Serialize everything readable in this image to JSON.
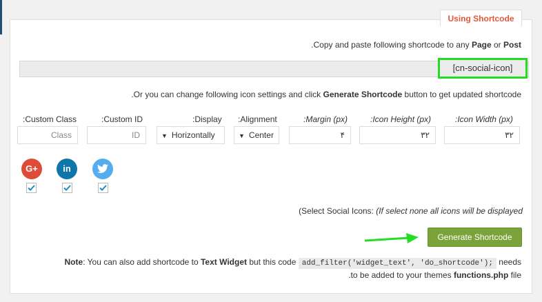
{
  "tab_title": "Using Shortcode",
  "intro": {
    "prefix": ".Copy and paste following shortcode to any ",
    "page": "Page",
    "or": " or ",
    "post": "Post"
  },
  "shortcode": "[cn-social-icon]",
  "change_text": {
    "prefix": ".Or you can change following icon settings and click ",
    "bold": "Generate Shortcode",
    "suffix": " button to get updated shortcode"
  },
  "fields": {
    "custom_class": {
      "label": ":Custom Class",
      "placeholder": "Class"
    },
    "custom_id": {
      "label": ":Custom ID",
      "placeholder": "ID"
    },
    "display": {
      "label": ":Display",
      "value": "Horizontally"
    },
    "alignment": {
      "label": ":Alignment",
      "value": "Center"
    },
    "margin": {
      "label": ":Margin (px)",
      "value": "۴"
    },
    "icon_height": {
      "label": ":Icon Height (px)",
      "value": "۳۲"
    },
    "icon_width": {
      "label": ":Icon Width (px)",
      "value": "۳۲"
    }
  },
  "social_icons": [
    {
      "name": "Google Plus",
      "glyph": "G+",
      "color": "#dd4b39",
      "checked": true
    },
    {
      "name": "LinkedIn",
      "glyph": "in",
      "color": "#0e76a8",
      "checked": true
    },
    {
      "name": "Twitter",
      "glyph": "t",
      "color": "#55acee",
      "checked": true
    }
  ],
  "select_social": {
    "prefix": "(Select Social Icons: ",
    "italic": "(If select none all icons will be displayed"
  },
  "generate_button": "Generate Shortcode",
  "note": {
    "label": "Note",
    "part1": ": You can also add shortcode to ",
    "widget": "Text Widget",
    "part2": " but this code ",
    "code": "add_filter('widget_text', 'do_shortcode');",
    "part3": " needs",
    "line2_prefix": ".to be added to your themes ",
    "file": "functions.php",
    "line2_suffix": " file"
  }
}
